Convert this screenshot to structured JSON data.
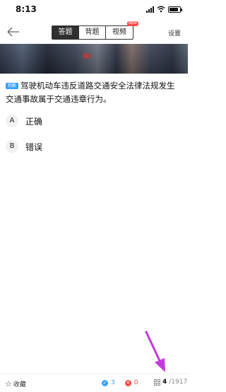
{
  "status": {
    "time": "8:13"
  },
  "nav": {
    "tabs": [
      {
        "label": "答题",
        "active": true
      },
      {
        "label": "背题",
        "active": false
      },
      {
        "label": "视频",
        "active": false,
        "badge": "NEW"
      }
    ],
    "settings": "设置"
  },
  "question": {
    "tag": "判断",
    "text": "驾驶机动车违反道路交通安全法律法规发生交通事故属于交通违章行为。"
  },
  "options": [
    {
      "letter": "A",
      "text": "正确"
    },
    {
      "letter": "B",
      "text": "错误"
    }
  ],
  "bottom": {
    "favorite_label": "收藏",
    "correct_count": "3",
    "wrong_count": "0",
    "progress_current": "4",
    "progress_total": "/1917"
  },
  "colors": {
    "accent": "#3aa0ff",
    "error": "#f04a4a",
    "annotation": "#c23bd9"
  }
}
